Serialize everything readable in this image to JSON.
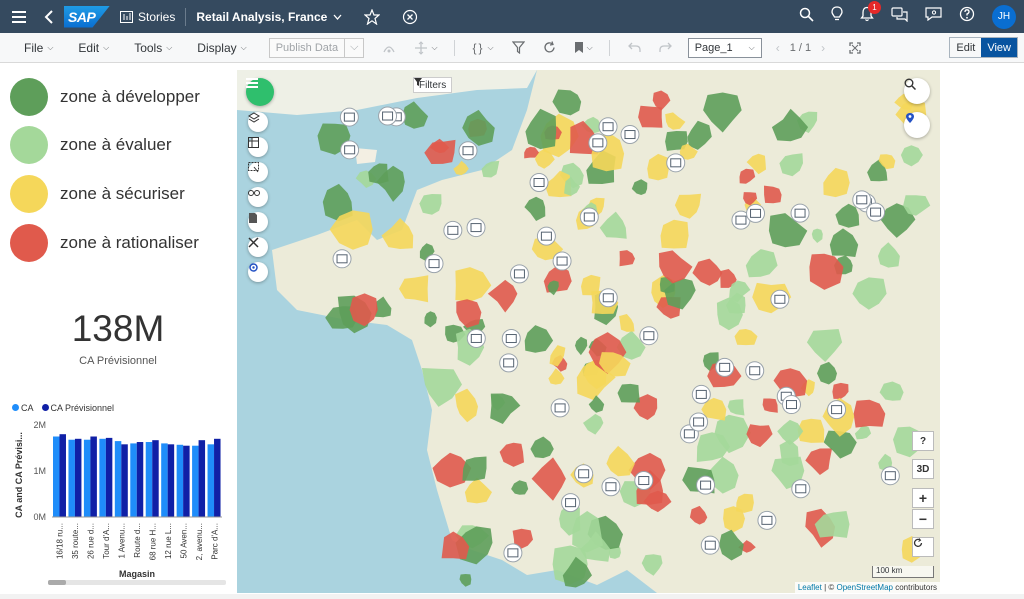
{
  "shell": {
    "app_label": "Stories",
    "story_title": "Retail Analysis, France",
    "notification_count": "1",
    "user_initials": "JH",
    "logo_text": "SAP"
  },
  "toolbar": {
    "file": "File",
    "edit": "Edit",
    "tools": "Tools",
    "display": "Display",
    "publish": "Publish Data",
    "page_select": "Page_1",
    "page_count": "1 / 1",
    "edit_mode": "Edit",
    "view_mode": "View"
  },
  "legend": {
    "items": [
      {
        "label": "zone à développer",
        "color": "#5e9e5a"
      },
      {
        "label": "zone à évaluer",
        "color": "#a4d89a"
      },
      {
        "label": "zone à sécuriser",
        "color": "#f5d75a"
      },
      {
        "label": "zone à rationaliser",
        "color": "#e05a4c"
      }
    ]
  },
  "kpi": {
    "value": "138M",
    "label": "CA Prévisionnel"
  },
  "chart_data": {
    "type": "bar",
    "legend": [
      "CA",
      "CA Prévisionnel"
    ],
    "colors": [
      "#1f8dfa",
      "#1020a6"
    ],
    "xlabel": "Magasin",
    "ylabel": "CA and CA Prévisi...",
    "yticks": [
      "2M",
      "1M",
      "0M"
    ],
    "ylim": [
      0,
      2
    ],
    "categories": [
      "16/18 ru...",
      "35 route...",
      "26 rue d...",
      "Tour d'A...",
      "1 Avenu...",
      "Route d...",
      "68 rue H...",
      "12 rue L...",
      "50 Aven...",
      "2, avenu...",
      "Parc d'A..."
    ],
    "series": [
      {
        "name": "CA",
        "values": [
          1.75,
          1.68,
          1.68,
          1.7,
          1.65,
          1.6,
          1.63,
          1.6,
          1.57,
          1.55,
          1.58
        ]
      },
      {
        "name": "CA Prévisionnel",
        "values": [
          1.8,
          1.7,
          1.75,
          1.72,
          1.58,
          1.63,
          1.67,
          1.58,
          1.55,
          1.67,
          1.7
        ]
      }
    ]
  },
  "map": {
    "filters_label": "Filters",
    "help_label": "?",
    "threeD_label": "3D",
    "zoom_in": "+",
    "zoom_out": "−",
    "scale_label": "100 km",
    "attribution_leaflet": "Leaflet",
    "attribution_osm": "OpenStreetMap",
    "attribution_suffix": " contributors"
  }
}
